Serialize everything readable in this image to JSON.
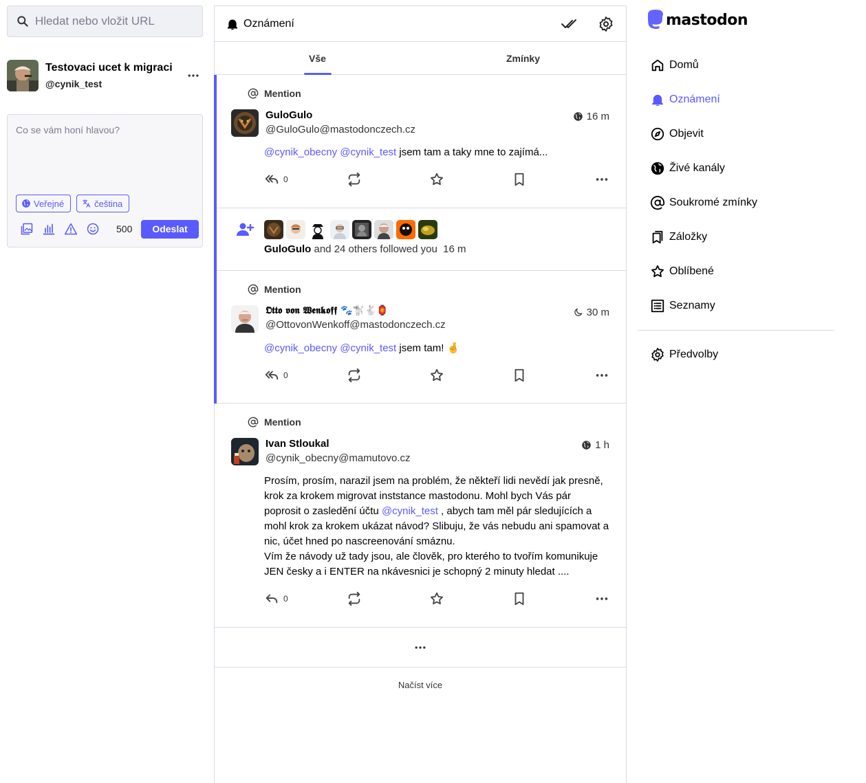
{
  "search": {
    "placeholder": "Hledat nebo vložit URL"
  },
  "profile": {
    "name": "Testovaci ucet k migraci",
    "handle": "@cynik_test",
    "menu": "•••"
  },
  "compose": {
    "placeholder": "Co se vám honí hlavou?",
    "visibility_label": "Veřejné",
    "language_label": "čeština",
    "char_count": "500",
    "send_label": "Odeslat"
  },
  "column": {
    "title": "Oznámení",
    "tabs": [
      {
        "label": "Vše"
      },
      {
        "label": "Zmínky"
      }
    ]
  },
  "notifications": [
    {
      "type_label": "Mention",
      "display_name": "GuloGulo",
      "account": "@GuloGulo@mastodonczech.cz",
      "time": "16 m",
      "mentions": [
        "@cynik_obecny",
        "@cynik_test"
      ],
      "text": " jsem tam a taky mne to zajímá...",
      "reply_count": "0"
    },
    {
      "follow_name": "GuloGulo",
      "follow_text": " and 24 others followed you",
      "time": "16 m"
    },
    {
      "type_label": "Mention",
      "display_name": "𝕺𝖙𝖙𝖔 𝖛𝖔𝖓 𝖂𝖊𝖓𝖐𝖔𝖋𝖋 🐾🐩🐇🏮",
      "account": "@OttovonWenkoff@mastodonczech.cz",
      "time": "30 m",
      "mentions": [
        "@cynik_obecny",
        "@cynik_test"
      ],
      "text": " jsem tam! 🤞",
      "reply_count": "0"
    },
    {
      "type_label": "Mention",
      "display_name": "Ivan Stloukal",
      "account": "@cynik_obecny@mamutovo.cz",
      "time": "1 h",
      "text_a": "Prosím, prosím, narazil jsem na problém, že někteří lidi nevědí jak presně, krok za krokem migrovat inststance mastodonu. Mohl bych Vás pár poprosit o zasledění účtu ",
      "mention": "@cynik_test",
      "text_b": " , abych tam měl pár sledujících a mohl krok za krokem ukázat návod? Slibuju, že vás nebudu ani spamovat a nic, účet hned po nascreenování smáznu.",
      "text_c": "Vím že návody už tady jsou, ale člověk, pro kterého to tvořím komunikuje JEN česky a i ENTER na nkávesnici je schopný 2 minuty hledat ....",
      "reply_count": "0"
    }
  ],
  "gap_label": "•••",
  "load_more": "Načíst více",
  "brand": {
    "logo_text": "mastodon",
    "accent": "#595aff"
  },
  "nav": {
    "items": [
      {
        "label": "Domů",
        "icon": "home-icon"
      },
      {
        "label": "Oznámení",
        "icon": "bell-icon"
      },
      {
        "label": "Objevit",
        "icon": "compass-icon"
      },
      {
        "label": "Živé kanály",
        "icon": "globe-icon"
      },
      {
        "label": "Soukromé zmínky",
        "icon": "at-icon"
      },
      {
        "label": "Záložky",
        "icon": "bookmark-icon"
      },
      {
        "label": "Oblíbené",
        "icon": "star-icon"
      },
      {
        "label": "Seznamy",
        "icon": "list-icon"
      }
    ],
    "preferences": {
      "label": "Předvolby",
      "icon": "gear-icon"
    }
  }
}
